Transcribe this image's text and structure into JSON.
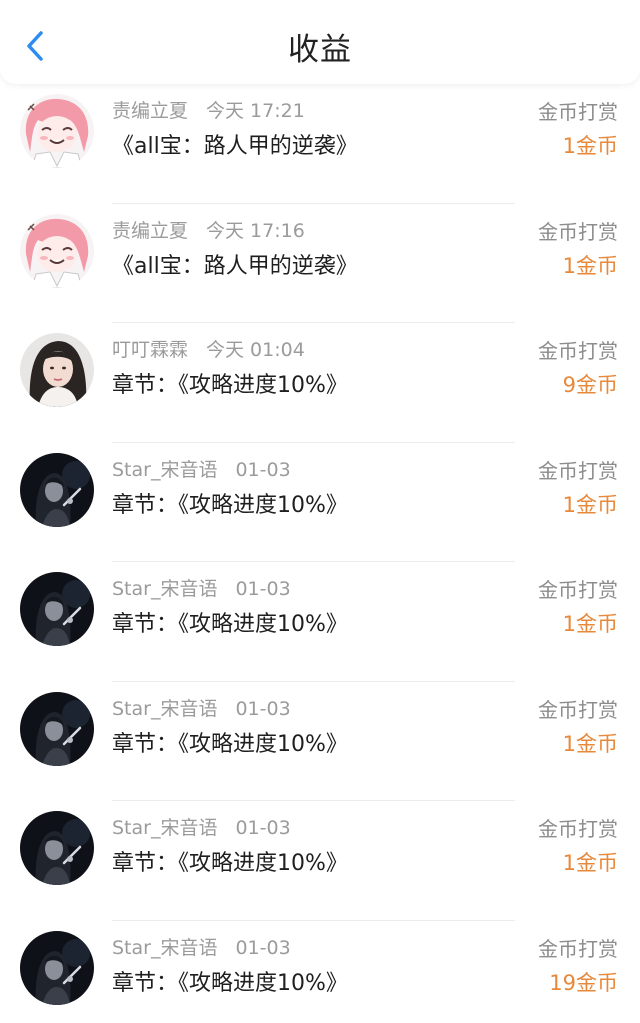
{
  "header": {
    "title": "收益",
    "back_icon": "chevron-left-icon",
    "accent_color": "#2d8cf0"
  },
  "colors": {
    "amount": "#e8883a",
    "meta": "#9b9b9b"
  },
  "records": [
    {
      "avatar": "anime-girl-avatar",
      "name": "责编立夏",
      "time": "今天 17:21",
      "work": "《all宝：路人甲的逆袭》",
      "type": "金币打赏",
      "amount": "1金币"
    },
    {
      "avatar": "anime-girl-avatar",
      "name": "责编立夏",
      "time": "今天 17:16",
      "work": "《all宝：路人甲的逆袭》",
      "type": "金币打赏",
      "amount": "1金币"
    },
    {
      "avatar": "photo-girl-avatar",
      "name": "叮叮霖霖",
      "time": "今天 01:04",
      "work": "章节：《攻略进度10%》",
      "type": "金币打赏",
      "amount": "9金币"
    },
    {
      "avatar": "dark-photo-avatar",
      "name": "Star_宋音语",
      "time": "01-03",
      "work": "章节：《攻略进度10%》",
      "type": "金币打赏",
      "amount": "1金币"
    },
    {
      "avatar": "dark-photo-avatar",
      "name": "Star_宋音语",
      "time": "01-03",
      "work": "章节：《攻略进度10%》",
      "type": "金币打赏",
      "amount": "1金币"
    },
    {
      "avatar": "dark-photo-avatar",
      "name": "Star_宋音语",
      "time": "01-03",
      "work": "章节：《攻略进度10%》",
      "type": "金币打赏",
      "amount": "1金币"
    },
    {
      "avatar": "dark-photo-avatar",
      "name": "Star_宋音语",
      "time": "01-03",
      "work": "章节：《攻略进度10%》",
      "type": "金币打赏",
      "amount": "1金币"
    },
    {
      "avatar": "dark-photo-avatar",
      "name": "Star_宋音语",
      "time": "01-03",
      "work": "章节：《攻略进度10%》",
      "type": "金币打赏",
      "amount": "19金币"
    }
  ]
}
